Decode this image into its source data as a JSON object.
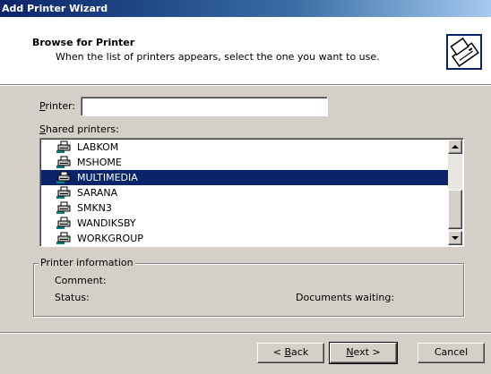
{
  "window": {
    "title": "Add Printer Wizard"
  },
  "header": {
    "title": "Browse for Printer",
    "subtitle": "When the list of printers appears, select the one you want to use.",
    "icon": "printer-wizard-icon"
  },
  "printer_field": {
    "label_accel": "P",
    "label_rest": "rinter:",
    "value": ""
  },
  "shared": {
    "label_accel": "S",
    "label_rest": "hared printers:",
    "items": [
      {
        "label": "LABKOM"
      },
      {
        "label": "MSHOME"
      },
      {
        "label": "MULTIMEDIA",
        "selected": true
      },
      {
        "label": "SARANA"
      },
      {
        "label": "SMKN3"
      },
      {
        "label": "WANDIKSBY"
      },
      {
        "label": "WORKGROUP"
      }
    ]
  },
  "info": {
    "legend": "Printer information",
    "comment_label": "Comment:",
    "comment_value": "",
    "status_label": "Status:",
    "status_value": "",
    "docs_label": "Documents waiting:",
    "docs_value": ""
  },
  "buttons": {
    "back_pre": "< ",
    "back_accel": "B",
    "back_rest": "ack",
    "next_accel": "N",
    "next_rest": "ext >",
    "cancel": "Cancel"
  },
  "colors": {
    "selection": "#0a246a",
    "face": "#d4d0c8"
  }
}
